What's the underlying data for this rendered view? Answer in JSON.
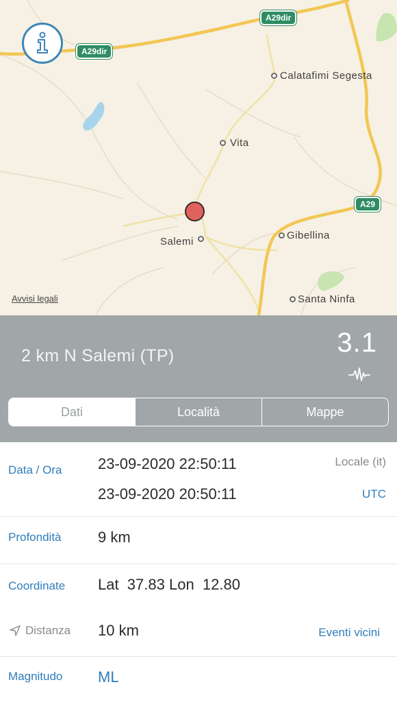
{
  "map": {
    "places": [
      "Calatafimi Segesta",
      "Vita",
      "Salemi",
      "Gibellina",
      "Santa Ninfa"
    ],
    "road_shields": [
      "A29dir",
      "A29dir",
      "A29"
    ],
    "legal_link": "Avvisi legali",
    "info_icon": "info-icon",
    "colors": {
      "land": "#f6f1e4",
      "highway": "#f3c654",
      "water": "#a7d4ec",
      "park": "#c7e4b1",
      "marker": "#e0625d",
      "accent": "#2f7dbb"
    }
  },
  "event": {
    "location": "2 km N Salemi (TP)",
    "magnitude": "3.1",
    "magnitude_icon": "seismograph-icon"
  },
  "tabs": [
    "Dati",
    "Località",
    "Mappe"
  ],
  "active_tab": "Dati",
  "details": {
    "date_label": "Data / Ora",
    "local_time": "23-09-2020 22:50:11",
    "local_label": "Locale (it)",
    "utc_time": "23-09-2020 20:50:11",
    "utc_label": "UTC",
    "depth_label": "Profondità",
    "depth_value": "9 km",
    "coord_label": "Coordinate",
    "coord_value": "Lat  37.83 Lon  12.80",
    "distance_label": "Distanza",
    "distance_value": "10 km",
    "distance_icon": "location-arrow-icon",
    "nearby_link": "Eventi vicini",
    "magnitude_label": "Magnitudo",
    "magnitude_type": "ML"
  }
}
